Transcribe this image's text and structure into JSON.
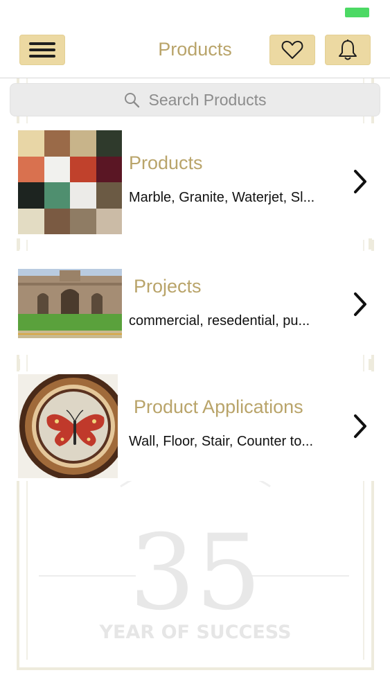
{
  "header": {
    "title": "Products"
  },
  "search": {
    "placeholder": "Search Products"
  },
  "rows": [
    {
      "title": "Products",
      "subtitle": "Marble, Granite, Waterjet, Sl..."
    },
    {
      "title": "Projects",
      "subtitle": "commercial, resedential, pu..."
    },
    {
      "title": "Product Applications",
      "subtitle": "Wall, Floor, Stair, Counter to..."
    }
  ],
  "watermark": {
    "number": "35",
    "tagline": "YEAR OF SUCCESS"
  },
  "colors": {
    "accent_button": "#ecd9a2",
    "title_gold": "#b9a46a",
    "battery_green": "#4cd964"
  }
}
